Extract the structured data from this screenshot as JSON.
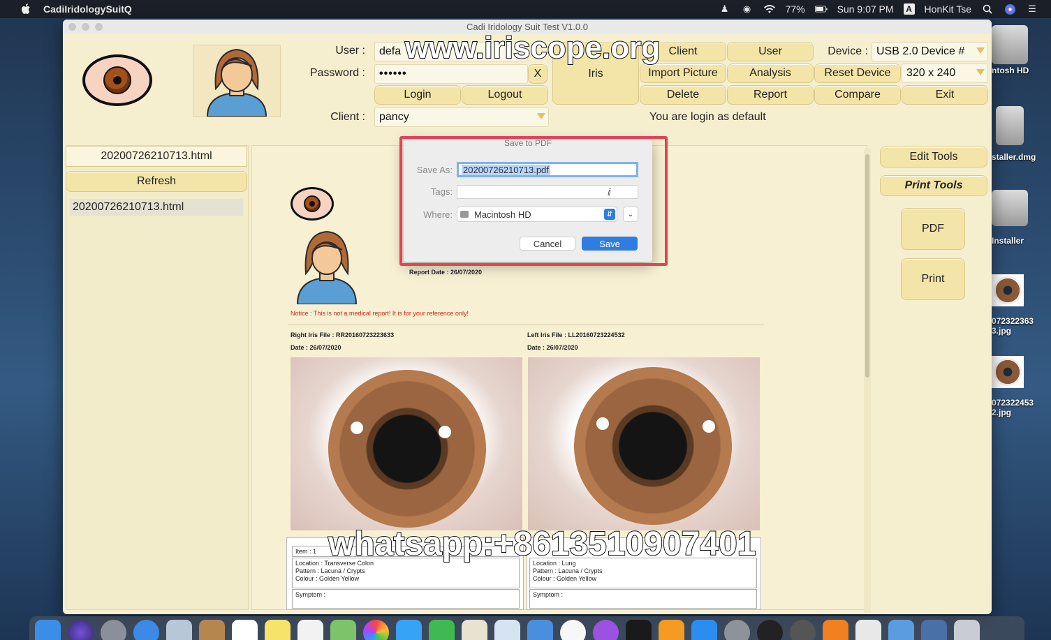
{
  "menubar": {
    "app_name": "CadiIridologySuitQ",
    "battery": "77%",
    "clock": "Sun 9:07 PM",
    "input_badge": "A",
    "user": "HonKit Tse"
  },
  "desktop": {
    "items": [
      {
        "label": "ntosh HD"
      },
      {
        "label": "staller.dmg"
      },
      {
        "label": "Installer"
      },
      {
        "label": "072322363\n3.jpg"
      },
      {
        "label": "072322453\n2.jpg"
      }
    ]
  },
  "window": {
    "title": "Cadi Iridology Suit Test V1.0.0",
    "login": {
      "user_label": "User :",
      "user_value": "defa",
      "password_label": "Password :",
      "password_value": "••••••",
      "clear_label": "X",
      "login_label": "Login",
      "logout_label": "Logout",
      "client_label": "Client :",
      "client_value": "pancy"
    },
    "toolbar": {
      "iris": "Iris",
      "client": "Client",
      "user": "User",
      "import_picture": "Import Picture",
      "analysis": "Analysis",
      "delete": "Delete",
      "report": "Report",
      "reset_device": "Reset Device",
      "compare": "Compare",
      "exit": "Exit",
      "device_label": "Device :",
      "device_value": "USB 2.0 Device #",
      "resolution_value": "320 x 240",
      "status": "You are login as default"
    },
    "files": {
      "current_file": "20200726210713.html",
      "refresh": "Refresh",
      "list": [
        "20200726210713.html"
      ]
    },
    "side_tools": {
      "edit_tools": "Edit Tools",
      "print_tools": "Print Tools",
      "pdf": "PDF",
      "print": "Print"
    },
    "report": {
      "report_date": "Report Date : 26/07/2020",
      "notice": "Notice : This is not a medical report! It is for your reference only!",
      "right_file": "Right Iris File : RR20160723223633",
      "right_date": "Date : 26/07/2020",
      "left_file": "Left Iris File : LL20160723224532",
      "left_date": "Date : 26/07/2020",
      "right_item": {
        "item": "Item : 1",
        "location": "Location : Transverse Colon",
        "pattern": "Pattern : Lacuna / Crypts",
        "colour": "Colour : Golden Yellow",
        "symptom": "Symptom :"
      },
      "left_item": {
        "location": "Location : Lung",
        "pattern": "Pattern : Lacuna / Crypts",
        "colour": "Colour : Golden Yellow",
        "symptom": "Symptom :"
      }
    }
  },
  "dialog": {
    "title": "Save to PDF",
    "save_as_label": "Save As:",
    "save_as_value": "20200726210713.pdf",
    "tags_label": "Tags:",
    "tags_value": "",
    "where_label": "Where:",
    "where_value": "Macintosh HD",
    "cancel": "Cancel",
    "save": "Save"
  },
  "overlays": {
    "top_watermark": "www.iriscope.org",
    "bottom_watermark": "whatsapp:+8613510907401"
  },
  "colors": {
    "window_bg": "#f6efcf",
    "button_bg": "#f3e4a8",
    "accent_blue": "#2f7de1",
    "highlight_red": "#e4415a",
    "notice_red": "#d0261c"
  }
}
